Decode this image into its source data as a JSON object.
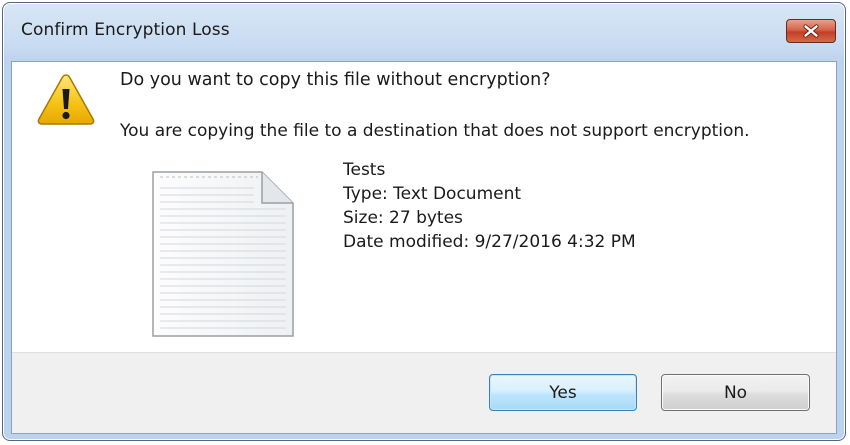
{
  "window": {
    "title": "Confirm Encryption Loss"
  },
  "message": {
    "question": "Do you want to copy this file without encryption?",
    "detail": "You are copying the file to a destination that does not support encryption."
  },
  "file": {
    "name": "Tests",
    "type": "Type: Text Document",
    "size": "Size: 27 bytes",
    "modified": "Date modified: 9/27/2016 4:32 PM",
    "icon": "text-document-icon"
  },
  "buttons": {
    "yes_label": "Yes",
    "no_label": "No"
  },
  "icons": {
    "warning": "warning-icon",
    "close": "close-icon"
  },
  "colors": {
    "titlebar": "#c9dcf2",
    "close_button": "#c23f26",
    "warning_yellow": "#f5c518",
    "default_button_border": "#3c7fb1"
  }
}
